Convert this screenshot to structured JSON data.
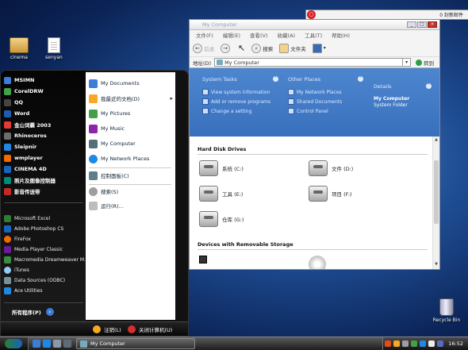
{
  "desktop": {
    "icons": [
      {
        "label": "cinema"
      },
      {
        "label": "senyan"
      },
      {
        "label": "Recycle Bin"
      }
    ]
  },
  "notification": {
    "text": "0 封新邮件"
  },
  "start_menu": {
    "pinned": [
      {
        "label": "MSIMN",
        "color": "#3b7dd8"
      },
      {
        "label": "CorelDRW",
        "color": "#43a047"
      },
      {
        "label": "QQ",
        "color": "#111111"
      },
      {
        "label": "Word",
        "color": "#1e5cb3"
      },
      {
        "label": "金山词霸 2003",
        "color": "#e53935"
      },
      {
        "label": "Rhinoceros",
        "color": "#6d6d6d"
      },
      {
        "label": "Sleipnir",
        "color": "#1e88e5"
      },
      {
        "label": "wmplayer",
        "color": "#ef6c00"
      },
      {
        "label": "CINEMA 4D",
        "color": "#1565c0"
      },
      {
        "label": "照片及图像控制器",
        "color": "#00897b"
      },
      {
        "label": "影音传送带",
        "color": "#c62828"
      }
    ],
    "recent": [
      {
        "label": "Microsoft Excel",
        "color": "#2e7d32"
      },
      {
        "label": "Adobe Photoshop CS",
        "color": "#1565c0"
      },
      {
        "label": "FireFox",
        "color": "#ef6c00"
      },
      {
        "label": "Media Player Classic",
        "color": "#6a1b9a"
      },
      {
        "label": "Macromedia Dreamweaver M...",
        "color": "#388e3c"
      },
      {
        "label": "iTunes",
        "color": "#90caf9"
      },
      {
        "label": "Data Sources (ODBC)",
        "color": "#78909c"
      },
      {
        "label": "Ace Utilities",
        "color": "#1e88e5"
      }
    ],
    "all_programs": "所有程序(P)",
    "places": [
      {
        "label": "My Documents",
        "color": "#3b7dd8",
        "submenu": false
      },
      {
        "label": "我最近的文档(D)",
        "color": "#f9a825",
        "submenu": true
      },
      {
        "label": "My Pictures",
        "color": "#43a047",
        "submenu": false
      },
      {
        "label": "My Music",
        "color": "#8e24aa",
        "submenu": false
      },
      {
        "label": "My Computer",
        "color": "#546e7a",
        "submenu": false
      },
      {
        "label": "My Network Places",
        "color": "#1e88e5",
        "submenu": false
      }
    ],
    "system": [
      {
        "label": "控制面板(C)",
        "color": "#607d8b"
      },
      {
        "label": "搜索(S)",
        "color": "#9e9e9e"
      },
      {
        "label": "运行(R)...",
        "color": "#bdbdbd"
      }
    ],
    "logoff": "注销(L)",
    "shutdown": "关闭计算机(U)"
  },
  "window": {
    "title": "My Computer",
    "menu": [
      "文件(F)",
      "编辑(E)",
      "查看(V)",
      "收藏(A)",
      "工具(T)",
      "帮助(H)"
    ],
    "toolbar": {
      "back": "后退",
      "search": "搜索",
      "folders": "文件夹"
    },
    "address": {
      "label": "地址(D)",
      "value": "My Computer",
      "go": "转到"
    },
    "system_tasks": {
      "title": "System Tasks",
      "items": [
        "View system information",
        "Add or remove programs",
        "Change a setting"
      ]
    },
    "other_places": {
      "title": "Other Places",
      "items": [
        "My Network Places",
        "Shared Documents",
        "Control Panel"
      ]
    },
    "details": {
      "title": "Details",
      "name": "My Computer",
      "type": "System Folder"
    },
    "hard_disk_group": "Hard Disk Drives",
    "drives": [
      {
        "label": "系统 (C:)"
      },
      {
        "label": "文件 (D:)"
      },
      {
        "label": "工具 (E:)"
      },
      {
        "label": "项目 (F:)"
      },
      {
        "label": "仓库 (G:)"
      }
    ],
    "removable_group": "Devices with Removable Storage"
  },
  "taskbar": {
    "task_label": "My Computer",
    "clock": "16:52"
  }
}
